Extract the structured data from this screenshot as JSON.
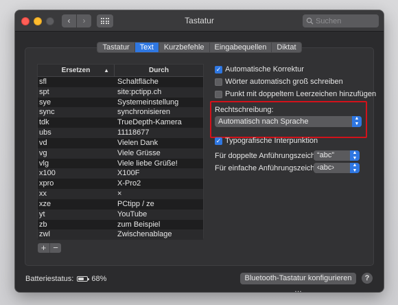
{
  "window": {
    "title": "Tastatur",
    "nav_back": "‹",
    "nav_forward": "›"
  },
  "search": {
    "placeholder": "Suchen",
    "value": ""
  },
  "tabs": [
    {
      "label": "Tastatur",
      "active": false
    },
    {
      "label": "Text",
      "active": true
    },
    {
      "label": "Kurzbefehle",
      "active": false
    },
    {
      "label": "Eingabequellen",
      "active": false
    },
    {
      "label": "Diktat",
      "active": false
    }
  ],
  "table": {
    "col_replace": "Ersetzen",
    "col_with": "Durch",
    "sort_indicator": "▲",
    "rows": [
      {
        "replace": "sfl",
        "with": "Schaltfläche"
      },
      {
        "replace": "spt",
        "with": "site:pctipp.ch"
      },
      {
        "replace": "sye",
        "with": "Systemeinstellung"
      },
      {
        "replace": "sync",
        "with": "synchronisieren"
      },
      {
        "replace": "tdk",
        "with": "TrueDepth-Kamera"
      },
      {
        "replace": "ubs",
        "with": "11118677"
      },
      {
        "replace": "vd",
        "with": "Vielen Dank"
      },
      {
        "replace": "vg",
        "with": "Viele Grüsse"
      },
      {
        "replace": "vlg",
        "with": "Viele liebe Grüße!"
      },
      {
        "replace": "x100",
        "with": "X100F"
      },
      {
        "replace": "xpro",
        "with": "X-Pro2"
      },
      {
        "replace": "xx",
        "with": "×"
      },
      {
        "replace": "xze",
        "with": "PCtipp / ze"
      },
      {
        "replace": "yt",
        "with": "YouTube"
      },
      {
        "replace": "zb",
        "with": "zum Beispiel"
      },
      {
        "replace": "zwl",
        "with": "Zwischenablage"
      }
    ],
    "add_label": "+",
    "remove_label": "−"
  },
  "options": {
    "auto_correct": {
      "label": "Automatische Korrektur",
      "checked": true
    },
    "auto_capitalize": {
      "label": "Wörter automatisch groß schreiben",
      "checked": false
    },
    "double_space_period": {
      "label": "Punkt mit doppeltem Leerzeichen hinzufügen",
      "checked": false
    }
  },
  "spelling": {
    "label": "Rechtschreibung:",
    "value": "Automatisch nach Sprache"
  },
  "typography": {
    "smart_quotes": {
      "label": "Typografische Interpunktion",
      "checked": true
    },
    "double_quotes": {
      "label": "Für doppelte Anführungszeichen",
      "value": "“abc”"
    },
    "single_quotes": {
      "label": "Für einfache Anführungszeichen",
      "value": "‹abc›"
    }
  },
  "footer": {
    "battery_label": "Batteriestatus:",
    "battery_percent": "68%",
    "battery_level": 0.68,
    "bluetooth_button": "Bluetooth-Tastatur konfigurieren …",
    "help": "?"
  },
  "colors": {
    "accent": "#2f77e1",
    "highlight_box": "#d3121a",
    "window_bg": "#2b2b2d"
  }
}
